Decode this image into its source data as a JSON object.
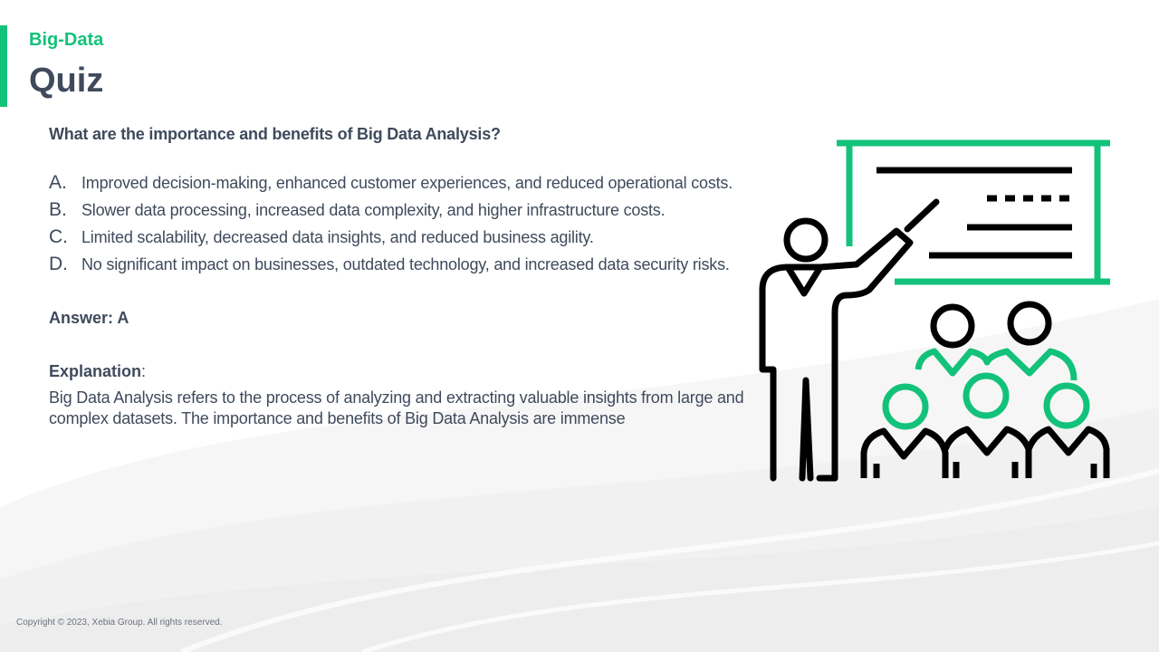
{
  "header": {
    "category": "Big-Data",
    "title": "Quiz"
  },
  "quiz": {
    "question": "What are the importance and benefits of Big Data Analysis?",
    "options": [
      {
        "letter": "A.",
        "text": "Improved decision-making, enhanced customer experiences, and reduced operational costs."
      },
      {
        "letter": "B.",
        "text": "Slower data processing, increased data complexity, and higher infrastructure costs."
      },
      {
        "letter": "C.",
        "text": "Limited scalability, decreased data insights, and reduced business agility."
      },
      {
        "letter": "D.",
        "text": "No significant impact on businesses, outdated technology, and increased data security risks."
      }
    ],
    "answer": "Answer: A",
    "explanation_label": "Explanation",
    "explanation_colon": ":",
    "explanation_text": "Big Data Analysis refers to the process of analyzing and extracting valuable insights from large and complex datasets. The importance and benefits of Big Data Analysis are immense"
  },
  "illustration": {
    "icon": "presentation-audience-icon"
  },
  "footer": {
    "copyright": "Copyright © 2023, Xebia Group. All rights reserved."
  },
  "colors": {
    "accent": "#13c27a",
    "text": "#3f4a5c",
    "icon_dark": "#000000"
  }
}
